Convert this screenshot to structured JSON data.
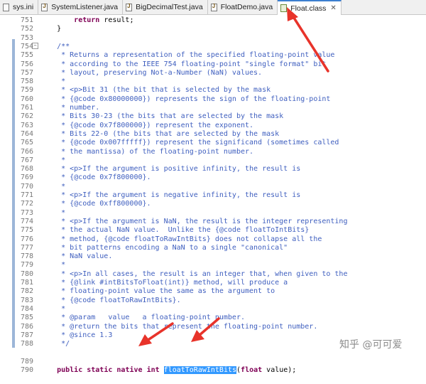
{
  "tabs": [
    {
      "label": "sys.ini",
      "icon": "ini-file-icon",
      "active": false
    },
    {
      "label": "SystemListener.java",
      "icon": "java-file-icon",
      "active": false
    },
    {
      "label": "BigDecimalTest.java",
      "icon": "java-file-icon",
      "active": false
    },
    {
      "label": "FloatDemo.java",
      "icon": "java-file-icon",
      "active": false
    },
    {
      "label": "Float.class",
      "icon": "class-file-icon",
      "active": true,
      "close": "✕"
    }
  ],
  "code_lines": [
    {
      "n": "751",
      "text": "        return result;"
    },
    {
      "n": "752",
      "text": "    }"
    },
    {
      "n": "753",
      "text": ""
    },
    {
      "n": "754",
      "text": "    /**"
    },
    {
      "n": "755",
      "text": "     * Returns a representation of the specified floating-point value"
    },
    {
      "n": "756",
      "text": "     * according to the IEEE 754 floating-point \"single format\" bit"
    },
    {
      "n": "757",
      "text": "     * layout, preserving Not-a-Number (NaN) values."
    },
    {
      "n": "758",
      "text": "     *"
    },
    {
      "n": "759",
      "text": "     * <p>Bit 31 (the bit that is selected by the mask"
    },
    {
      "n": "760",
      "text": "     * {@code 0x80000000}) represents the sign of the floating-point"
    },
    {
      "n": "761",
      "text": "     * number."
    },
    {
      "n": "762",
      "text": "     * Bits 30-23 (the bits that are selected by the mask"
    },
    {
      "n": "763",
      "text": "     * {@code 0x7f800000}) represent the exponent."
    },
    {
      "n": "764",
      "text": "     * Bits 22-0 (the bits that are selected by the mask"
    },
    {
      "n": "765",
      "text": "     * {@code 0x007fffff}) represent the significand (sometimes called"
    },
    {
      "n": "766",
      "text": "     * the mantissa) of the floating-point number."
    },
    {
      "n": "767",
      "text": "     *"
    },
    {
      "n": "768",
      "text": "     * <p>If the argument is positive infinity, the result is"
    },
    {
      "n": "769",
      "text": "     * {@code 0x7f800000}."
    },
    {
      "n": "770",
      "text": "     *"
    },
    {
      "n": "771",
      "text": "     * <p>If the argument is negative infinity, the result is"
    },
    {
      "n": "772",
      "text": "     * {@code 0xff800000}."
    },
    {
      "n": "773",
      "text": "     *"
    },
    {
      "n": "774",
      "text": "     * <p>If the argument is NaN, the result is the integer representing"
    },
    {
      "n": "775",
      "text": "     * the actual NaN value.  Unlike the {@code floatToIntBits}"
    },
    {
      "n": "776",
      "text": "     * method, {@code floatToRawIntBits} does not collapse all the"
    },
    {
      "n": "777",
      "text": "     * bit patterns encoding a NaN to a single \"canonical\""
    },
    {
      "n": "778",
      "text": "     * NaN value."
    },
    {
      "n": "779",
      "text": "     *"
    },
    {
      "n": "780",
      "text": "     * <p>In all cases, the result is an integer that, when given to the"
    },
    {
      "n": "781",
      "text": "     * {@link #intBitsToFloat(int)} method, will produce a"
    },
    {
      "n": "782",
      "text": "     * floating-point value the same as the argument to"
    },
    {
      "n": "783",
      "text": "     * {@code floatToRawIntBits}."
    },
    {
      "n": "784",
      "text": "     *"
    },
    {
      "n": "785",
      "text": "     * @param   value   a floating-point number."
    },
    {
      "n": "786",
      "text": "     * @return the bits that represent the floating-point number."
    },
    {
      "n": "787",
      "text": "     * @since 1.3"
    },
    {
      "n": "788",
      "text": "     */"
    }
  ],
  "native_line": {
    "n": "789",
    "kw1": "public",
    "kw2": "static",
    "kw3": "native",
    "kw4": "int",
    "method": "floatToRawIntBits",
    "sig_open": "(",
    "kw5": "float",
    "rest": " value);"
  },
  "trailing_line": {
    "n": "790",
    "text": ""
  },
  "fold_marker": "−",
  "watermark": "知乎 @可可爱",
  "colors": {
    "keyword": "#7f0055",
    "comment": "#3f5fbf",
    "selection": "#3399ff",
    "annotation_arrow": "#e8332a"
  }
}
